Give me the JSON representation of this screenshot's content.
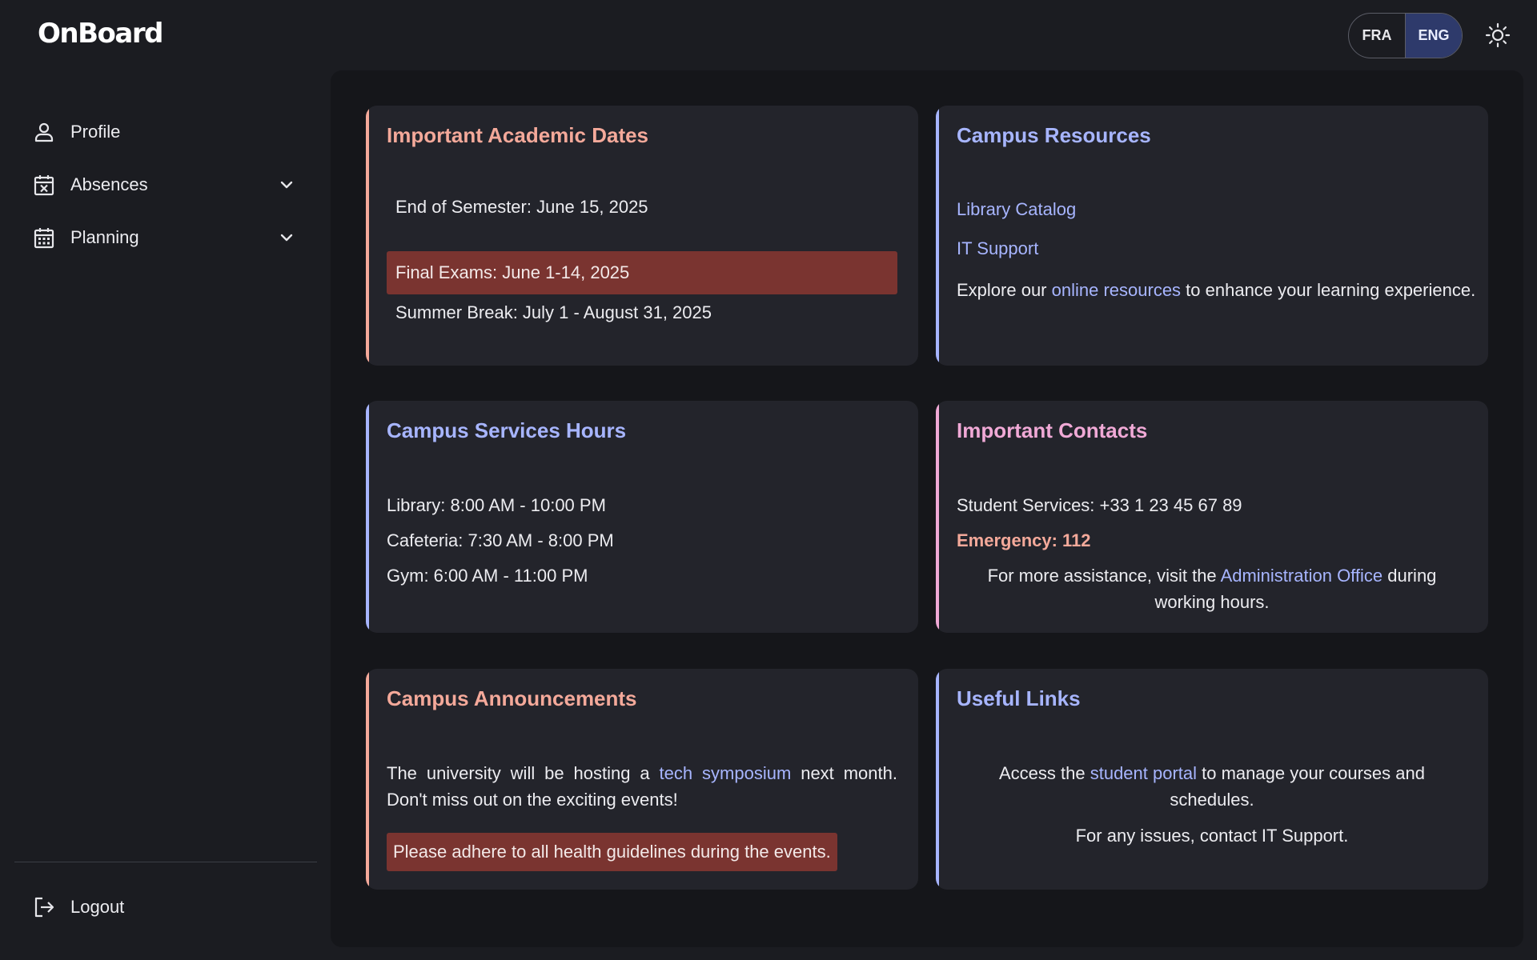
{
  "app": {
    "logo": "OnBoard"
  },
  "header": {
    "lang_fra": "FRA",
    "lang_eng": "ENG",
    "active_lang": "ENG",
    "theme_icon": "sun-icon"
  },
  "sidebar": {
    "items": [
      {
        "label": "Profile",
        "icon": "user-icon"
      },
      {
        "label": "Absences",
        "icon": "calendar-x-icon",
        "expandable": true
      },
      {
        "label": "Planning",
        "icon": "calendar-grid-icon",
        "expandable": true
      }
    ],
    "logout_label": "Logout"
  },
  "cards": {
    "academic_dates": {
      "title": "Important Academic Dates",
      "items": [
        "End of Semester: June 15, 2025",
        "Final Exams: June 1-14, 2025",
        "Summer Break: July 1 - August 31, 2025"
      ]
    },
    "resources": {
      "title": "Campus Resources",
      "link1": "Library Catalog",
      "link2": "IT Support",
      "text_pre": "Explore our ",
      "text_link": "online resources",
      "text_post": " to enhance your learning experience."
    },
    "hours": {
      "title": "Campus Services Hours",
      "items": [
        "Library: 8:00 AM - 10:00 PM",
        "Cafeteria: 7:30 AM - 8:00 PM",
        "Gym: 6:00 AM - 11:00 PM"
      ]
    },
    "contacts": {
      "title": "Important Contacts",
      "student_services": "Student Services: +33 1 23 45 67 89",
      "emergency": "Emergency: 112",
      "assist_pre": "For more assistance, visit the ",
      "assist_link": "Administration Office",
      "assist_post": " during working hours."
    },
    "announcements": {
      "title": "Campus Announcements",
      "text_pre": "The university will be hosting a ",
      "text_link": "tech symposium",
      "text_post": " next month. Don't miss out on the exciting events!",
      "alert": "Please adhere to all health guidelines during the events."
    },
    "useful_links": {
      "title": "Useful Links",
      "portal_pre": "Access the ",
      "portal_link": "student portal",
      "portal_post": " to manage your courses and schedules.",
      "issues": "For any issues, contact IT Support."
    }
  },
  "colors": {
    "background": "#1b1c21",
    "main_panel": "#15161a",
    "card": "#23242b",
    "accent_salmon": "#f4a99a",
    "accent_blue": "#a7b5ff",
    "accent_pink": "#f0a9d6",
    "highlight_red": "#7a3430"
  }
}
